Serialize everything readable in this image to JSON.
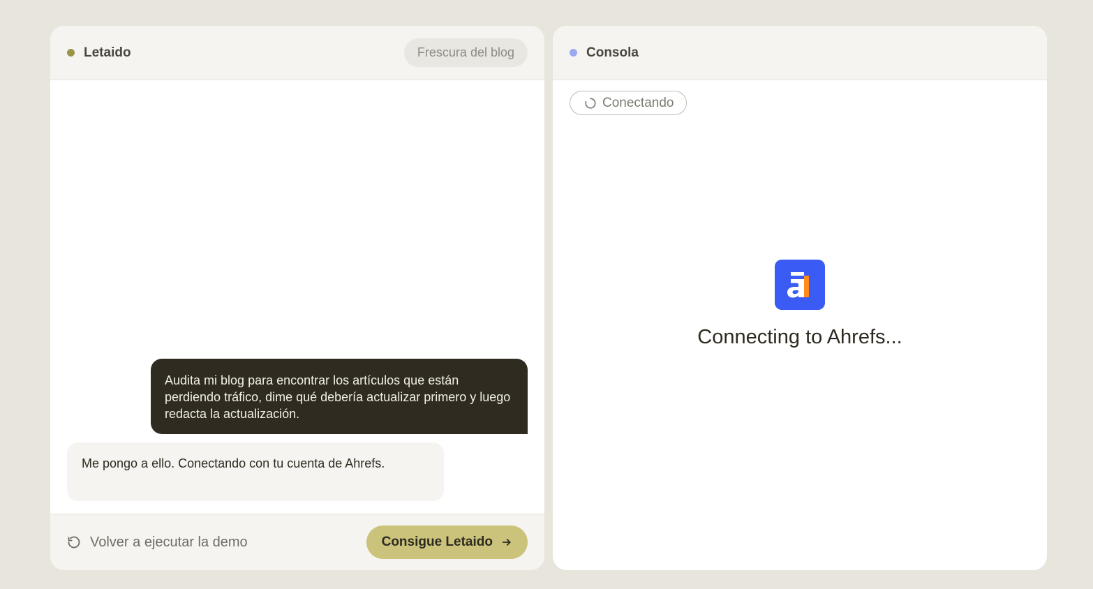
{
  "left_panel": {
    "title": "Letaido",
    "dot_color": "#9a9546",
    "pill_label": "Frescura del blog",
    "user_message": "Audita mi blog para encontrar los artículos que están perdiendo tráfico, dime qué debería actualizar primero y luego redacta la actualización.",
    "agent_message": "Me pongo a ello. Conectando con tu cuenta de Ahrefs.",
    "replay_label": "Volver a ejecutar la demo",
    "cta_label": "Consigue Letaido",
    "replay_icon": "rotate-ccw-icon",
    "cta_icon": "arrow-right-icon"
  },
  "right_panel": {
    "title": "Consola",
    "dot_color": "#9aa8f0",
    "status_label": "Conectando",
    "status_icon": "spinner-icon",
    "logo": "ahrefs-logo",
    "logo_color": "#3b5bf5",
    "connecting_text": "Connecting to Ahrefs..."
  }
}
